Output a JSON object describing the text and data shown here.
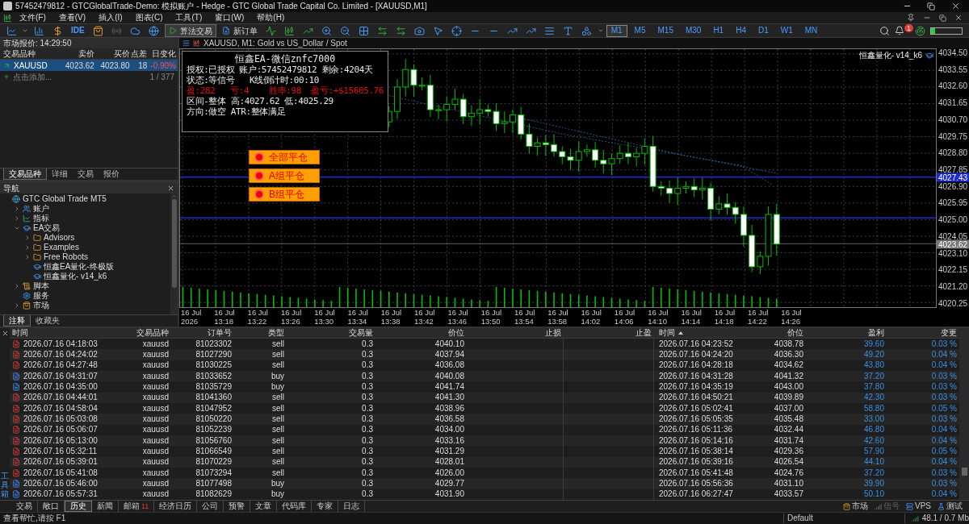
{
  "window": {
    "title": "57452479812 - GTCGlobalTrade-Demo: 模拟账户 - Hedge - GTC Global Trade Capital Co. Limited - [XAUUSD,M1]"
  },
  "menu": [
    "文件(F)",
    "查看(V)",
    "插入(I)",
    "图表(C)",
    "工具(T)",
    "窗口(W)",
    "帮助(H)"
  ],
  "toolbar": {
    "ide": "IDE",
    "algo_trading": {
      "label": "算法交易",
      "on": true
    },
    "new_order": "新订单",
    "timeframes": [
      {
        "label": "M1",
        "selected": true
      },
      {
        "label": "M5",
        "selected": false
      },
      {
        "label": "M15",
        "selected": false
      },
      {
        "label": "M30",
        "selected": false
      },
      {
        "label": "H1",
        "selected": false
      },
      {
        "label": "H4",
        "selected": false
      },
      {
        "label": "D1",
        "selected": false
      },
      {
        "label": "W1",
        "selected": false
      },
      {
        "label": "MN",
        "selected": false
      }
    ],
    "notification_badge": "1",
    "meter": {
      "level": 0.12
    }
  },
  "market_watch": {
    "title": "市场报价: 14:29:50",
    "columns": [
      "交易品种",
      "卖价",
      "买价",
      "点差",
      "日变化"
    ],
    "rows": [
      {
        "symbol": "XAUUSD",
        "bid": "4023.62",
        "ask": "4023.80",
        "spread": "18",
        "change": "-0.90%",
        "selected": true
      }
    ],
    "add_label": "点击添加...",
    "count": "1 / 377",
    "tabs": [
      {
        "label": "交易品种",
        "selected": true
      },
      {
        "label": "详细",
        "selected": false
      },
      {
        "label": "交易",
        "selected": false
      },
      {
        "label": "报价",
        "selected": false
      }
    ]
  },
  "navigator": {
    "title": "导航",
    "tree": [
      {
        "label": "GTC Global Trade MT5",
        "kind": "broker",
        "children": [
          {
            "label": "账户",
            "kind": "account",
            "expanded": false
          },
          {
            "label": "指标",
            "kind": "indicator",
            "expanded": false
          },
          {
            "label": "EA交易",
            "kind": "expert",
            "expanded": true,
            "children": [
              {
                "label": "Advisors",
                "kind": "folder",
                "expanded": false
              },
              {
                "label": "Examples",
                "kind": "folder",
                "expanded": false
              },
              {
                "label": "Free Robots",
                "kind": "folder",
                "expanded": false
              },
              {
                "label": "恒鑫EA量化-终极版",
                "kind": "robot"
              },
              {
                "label": "恒鑫量化- v14_k6",
                "kind": "robot"
              }
            ]
          },
          {
            "label": "脚本",
            "kind": "script",
            "expanded": false
          },
          {
            "label": "服务",
            "kind": "service"
          },
          {
            "label": "市场",
            "kind": "market",
            "expanded": false
          }
        ]
      }
    ],
    "tabs": [
      {
        "label": "注释",
        "selected": true
      },
      {
        "label": "收藏夹",
        "selected": false
      }
    ]
  },
  "chart": {
    "title": "XAUUSD, M1:  Gold vs US_Dollar / Spot",
    "ea_label": "恒鑫量化- v14_k6",
    "info_panel": {
      "title": "恒鑫EA-微信znfc7000",
      "lines": [
        {
          "text": "授权:已授权 账户:57452479812 剩余:4204天",
          "kind": "normal"
        },
        {
          "text": "状态:等信号   K线倒计时:00:10",
          "kind": "normal"
        },
        {
          "text": "盈:282   亏:4    胜率:98  盈亏:+$15605.76",
          "kind": "alert"
        },
        {
          "text": "区间-整体 高:4027.62 低:4025.29",
          "kind": "normal"
        },
        {
          "text": "方向:做空 ATR:整体满足",
          "kind": "normal"
        }
      ]
    },
    "action_buttons": [
      "全部平仓",
      "A组平仓",
      "B组平仓"
    ],
    "price_axis": [
      "4034.50",
      "4033.55",
      "4032.60",
      "4031.65",
      "4030.70",
      "4029.75",
      "4028.80",
      "4027.85",
      "4026.90",
      "4025.95",
      "4025.00",
      "4024.05",
      "4023.10",
      "4022.15",
      "4021.20",
      "4020.25"
    ],
    "price_tags": [
      {
        "label": "4027.43",
        "kind": "line"
      },
      {
        "label": "4023.62",
        "kind": "bid"
      }
    ],
    "time_axis": [
      "16 Jul 2026",
      "16 Jul 13:18",
      "16 Jul 13:22",
      "16 Jul 13:26",
      "16 Jul 13:30",
      "16 Jul 13:34",
      "16 Jul 13:38",
      "16 Jul 13:42",
      "16 Jul 13:46",
      "16 Jul 13:50",
      "16 Jul 13:54",
      "16 Jul 13:58",
      "16 Jul 14:02",
      "16 Jul 14:06",
      "16 Jul 14:10",
      "16 Jul 14:14",
      "16 Jul 14:18",
      "16 Jul 14:22",
      "16 Jul 14:26"
    ]
  },
  "history": {
    "columns": [
      {
        "label": "时间",
        "sorted": false
      },
      {
        "label": "交易品种",
        "sorted": false
      },
      {
        "label": "订单号",
        "sorted": false
      },
      {
        "label": "类型",
        "sorted": false
      },
      {
        "label": "交易量",
        "sorted": false
      },
      {
        "label": "价位",
        "sorted": false
      },
      {
        "label": "止损",
        "sorted": false
      },
      {
        "label": "止盈",
        "sorted": false
      },
      {
        "label": "时间",
        "sorted": true
      },
      {
        "label": "价位",
        "sorted": false
      },
      {
        "label": "盈利",
        "sorted": false
      },
      {
        "label": "变更",
        "sorted": false
      }
    ],
    "rows": [
      {
        "kind": "sell",
        "open_time": "2026.07.16 04:18:03",
        "symbol": "xauusd",
        "ticket": "81023302",
        "type": "sell",
        "volume": "0.3",
        "open_price": "4040.10",
        "close_time": "2026.07.16 04:23:52",
        "close_price": "4038.78",
        "profit": "39.60",
        "change": "0.03 %"
      },
      {
        "kind": "sell",
        "open_time": "2026.07.16 04:24:02",
        "symbol": "xauusd",
        "ticket": "81027290",
        "type": "sell",
        "volume": "0.3",
        "open_price": "4037.94",
        "close_time": "2026.07.16 04:24:20",
        "close_price": "4036.30",
        "profit": "49.20",
        "change": "0.04 %"
      },
      {
        "kind": "sell",
        "open_time": "2026.07.16 04:27:48",
        "symbol": "xauusd",
        "ticket": "81030225",
        "type": "sell",
        "volume": "0.3",
        "open_price": "4036.08",
        "close_time": "2026.07.16 04:28:18",
        "close_price": "4034.62",
        "profit": "43.80",
        "change": "0.04 %"
      },
      {
        "kind": "buy",
        "open_time": "2026.07.16 04:31:07",
        "symbol": "xauusd",
        "ticket": "81033652",
        "type": "buy",
        "volume": "0.3",
        "open_price": "4040.08",
        "close_time": "2026.07.16 04:31:28",
        "close_price": "4041.32",
        "profit": "37.20",
        "change": "0.03 %"
      },
      {
        "kind": "buy",
        "open_time": "2026.07.16 04:35:00",
        "symbol": "xauusd",
        "ticket": "81035729",
        "type": "buy",
        "volume": "0.3",
        "open_price": "4041.74",
        "close_time": "2026.07.16 04:35:19",
        "close_price": "4043.00",
        "profit": "37.80",
        "change": "0.03 %"
      },
      {
        "kind": "sell",
        "open_time": "2026.07.16 04:44:01",
        "symbol": "xauusd",
        "ticket": "81041360",
        "type": "sell",
        "volume": "0.3",
        "open_price": "4041.30",
        "close_time": "2026.07.16 04:50:21",
        "close_price": "4039.89",
        "profit": "42.30",
        "change": "0.03 %"
      },
      {
        "kind": "sell",
        "open_time": "2026.07.16 04:58:04",
        "symbol": "xauusd",
        "ticket": "81047952",
        "type": "sell",
        "volume": "0.3",
        "open_price": "4038.96",
        "close_time": "2026.07.16 05:02:41",
        "close_price": "4037.00",
        "profit": "58.80",
        "change": "0.05 %"
      },
      {
        "kind": "sell",
        "open_time": "2026.07.16 05:03:08",
        "symbol": "xauusd",
        "ticket": "81050220",
        "type": "sell",
        "volume": "0.3",
        "open_price": "4036.58",
        "close_time": "2026.07.16 05:05:35",
        "close_price": "4035.48",
        "profit": "33.00",
        "change": "0.03 %"
      },
      {
        "kind": "sell",
        "open_time": "2026.07.16 05:06:07",
        "symbol": "xauusd",
        "ticket": "81052239",
        "type": "sell",
        "volume": "0.3",
        "open_price": "4034.00",
        "close_time": "2026.07.16 05:11:36",
        "close_price": "4032.44",
        "profit": "46.80",
        "change": "0.04 %"
      },
      {
        "kind": "sell",
        "open_time": "2026.07.16 05:13:00",
        "symbol": "xauusd",
        "ticket": "81056760",
        "type": "sell",
        "volume": "0.3",
        "open_price": "4033.16",
        "close_time": "2026.07.16 05:14:16",
        "close_price": "4031.74",
        "profit": "42.60",
        "change": "0.04 %"
      },
      {
        "kind": "sell",
        "open_time": "2026.07.16 05:32:11",
        "symbol": "xauusd",
        "ticket": "81066549",
        "type": "sell",
        "volume": "0.3",
        "open_price": "4031.29",
        "close_time": "2026.07.16 05:38:14",
        "close_price": "4029.36",
        "profit": "57.90",
        "change": "0.05 %"
      },
      {
        "kind": "sell",
        "open_time": "2026.07.16 05:39:01",
        "symbol": "xauusd",
        "ticket": "81070229",
        "type": "sell",
        "volume": "0.3",
        "open_price": "4028.01",
        "close_time": "2026.07.16 05:39:16",
        "close_price": "4026.54",
        "profit": "44.10",
        "change": "0.04 %"
      },
      {
        "kind": "sell",
        "open_time": "2026.07.16 05:41:08",
        "symbol": "xauusd",
        "ticket": "81073294",
        "type": "sell",
        "volume": "0.3",
        "open_price": "4026.00",
        "close_time": "2026.07.16 05:41:48",
        "close_price": "4024.76",
        "profit": "37.20",
        "change": "0.03 %"
      },
      {
        "kind": "buy",
        "open_time": "2026.07.16 05:46:00",
        "symbol": "xauusd",
        "ticket": "81077498",
        "type": "buy",
        "volume": "0.3",
        "open_price": "4029.77",
        "close_time": "2026.07.16 05:56:36",
        "close_price": "4031.10",
        "profit": "39.90",
        "change": "0.03 %"
      },
      {
        "kind": "buy",
        "open_time": "2026.07.16 05:57:31",
        "symbol": "xauusd",
        "ticket": "81082629",
        "type": "buy",
        "volume": "0.3",
        "open_price": "4031.90",
        "close_time": "2026.07.16 06:27:47",
        "close_price": "4033.57",
        "profit": "50.10",
        "change": "0.04 %"
      }
    ]
  },
  "toolbox_label": "工具箱",
  "bottom_tabs": [
    {
      "label": "交易",
      "selected": false
    },
    {
      "label": "敞口",
      "selected": false
    },
    {
      "label": "历史",
      "selected": true
    },
    {
      "label": "新闻",
      "selected": false
    },
    {
      "label": "邮箱",
      "selected": false,
      "badge": "11"
    },
    {
      "label": "经济日历",
      "selected": false
    },
    {
      "label": "公司",
      "selected": false
    },
    {
      "label": "预警",
      "selected": false
    },
    {
      "label": "文章",
      "selected": false
    },
    {
      "label": "代码库",
      "selected": false
    },
    {
      "label": "专家",
      "selected": false
    },
    {
      "label": "日志",
      "selected": false
    }
  ],
  "services": [
    {
      "label": "市场",
      "kind": "market",
      "disabled": false
    },
    {
      "label": "信号",
      "kind": "signal",
      "disabled": true
    },
    {
      "label": "VPS",
      "kind": "vps",
      "disabled": false
    },
    {
      "label": "测试",
      "kind": "tester",
      "disabled": false
    }
  ],
  "status_bar": {
    "help": "查看帮忙,请按 F1",
    "profile": "Default",
    "traffic": "48.1 / 0.7 Mb"
  }
}
